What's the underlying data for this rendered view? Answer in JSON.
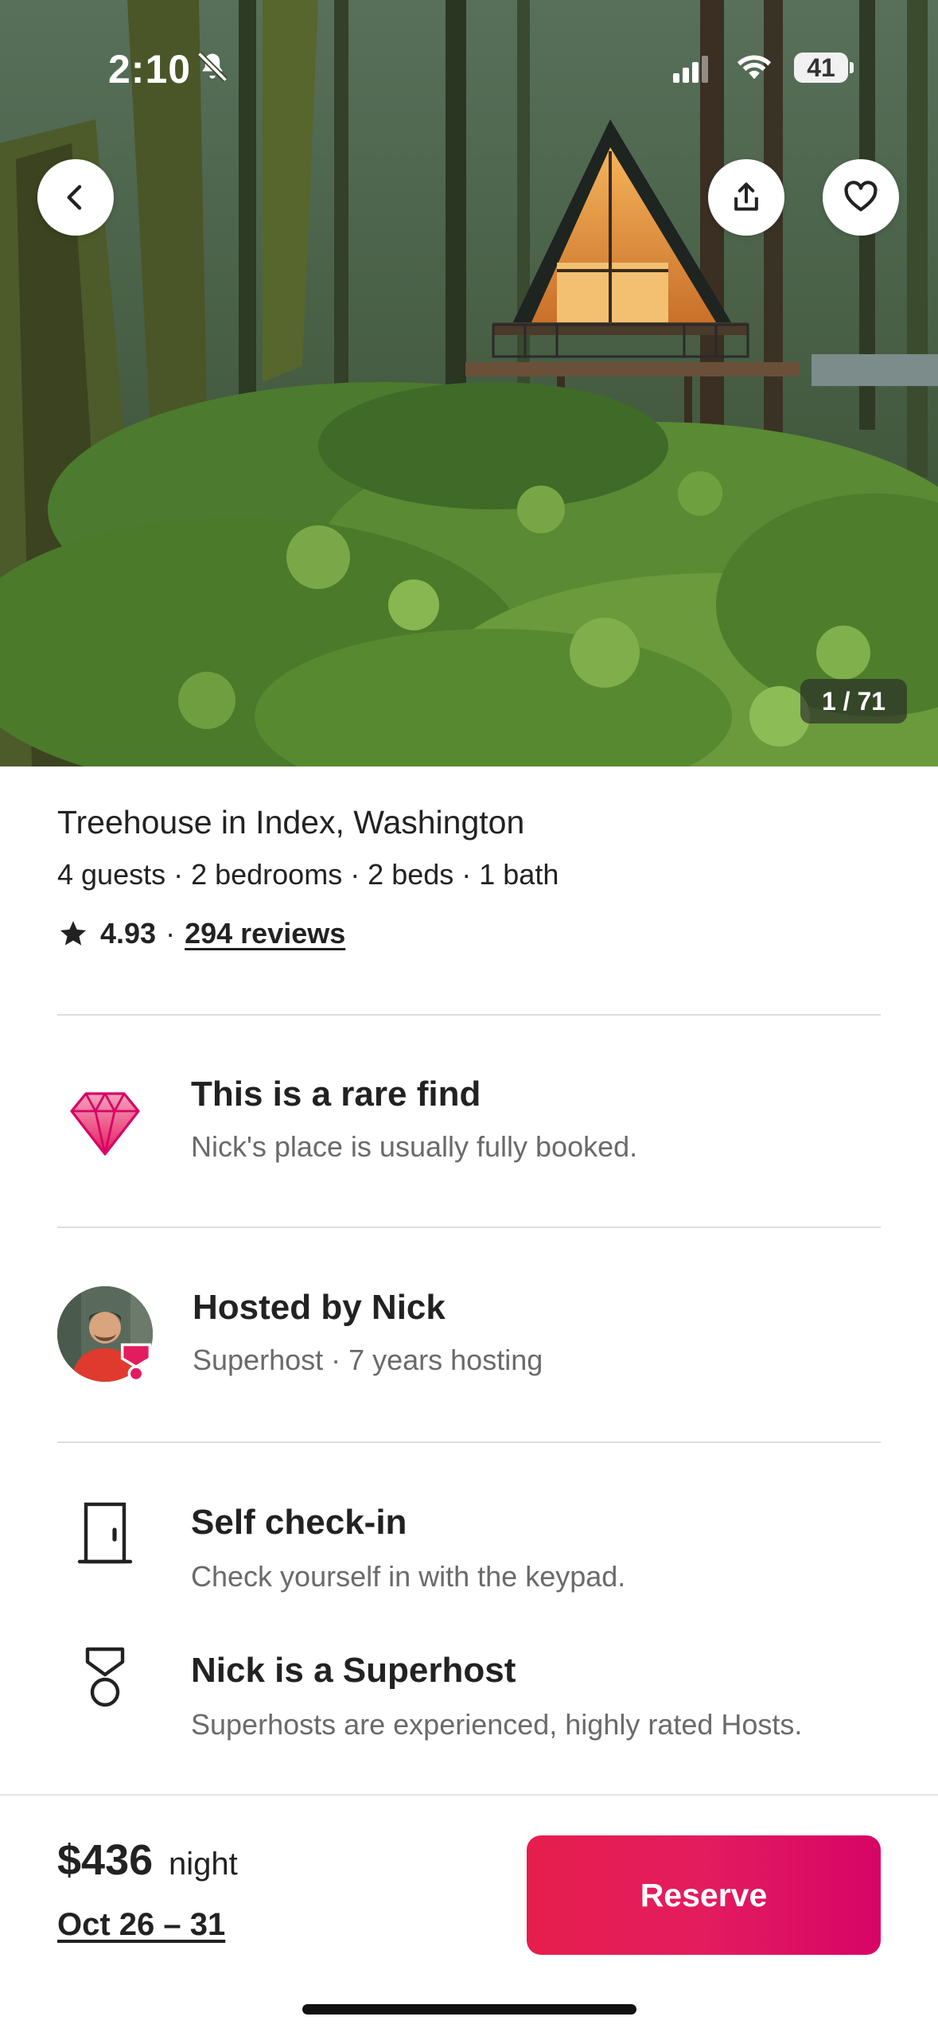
{
  "status_bar": {
    "time": "2:10",
    "battery": "41"
  },
  "hero": {
    "photo_counter": "1 / 71"
  },
  "listing": {
    "title": "Treehouse in Index, Washington",
    "details": "4 guests · 2 bedrooms · 2 beds · 1 bath",
    "rating": "4.93",
    "separator": "·",
    "reviews": "294 reviews"
  },
  "highlights": [
    {
      "title": "This is a rare find",
      "subtitle": "Nick's place is usually fully booked.",
      "icon": "diamond-icon"
    },
    {
      "title": "Hosted by Nick",
      "subtitle": "Superhost · 7 years hosting",
      "icon": "host-avatar"
    },
    {
      "title": "Self check-in",
      "subtitle": "Check yourself in with the keypad.",
      "icon": "door-icon"
    },
    {
      "title": "Nick is a Superhost",
      "subtitle": "Superhosts are experienced, highly rated Hosts.",
      "icon": "medal-icon"
    }
  ],
  "booking": {
    "price": "$436",
    "unit": "night",
    "dates": "Oct 26 – 31",
    "reserve_label": "Reserve"
  },
  "colors": {
    "brand": "#E31C5F",
    "text": "#222222",
    "muted": "#6A6A6A",
    "divider": "#DDDDDD"
  }
}
